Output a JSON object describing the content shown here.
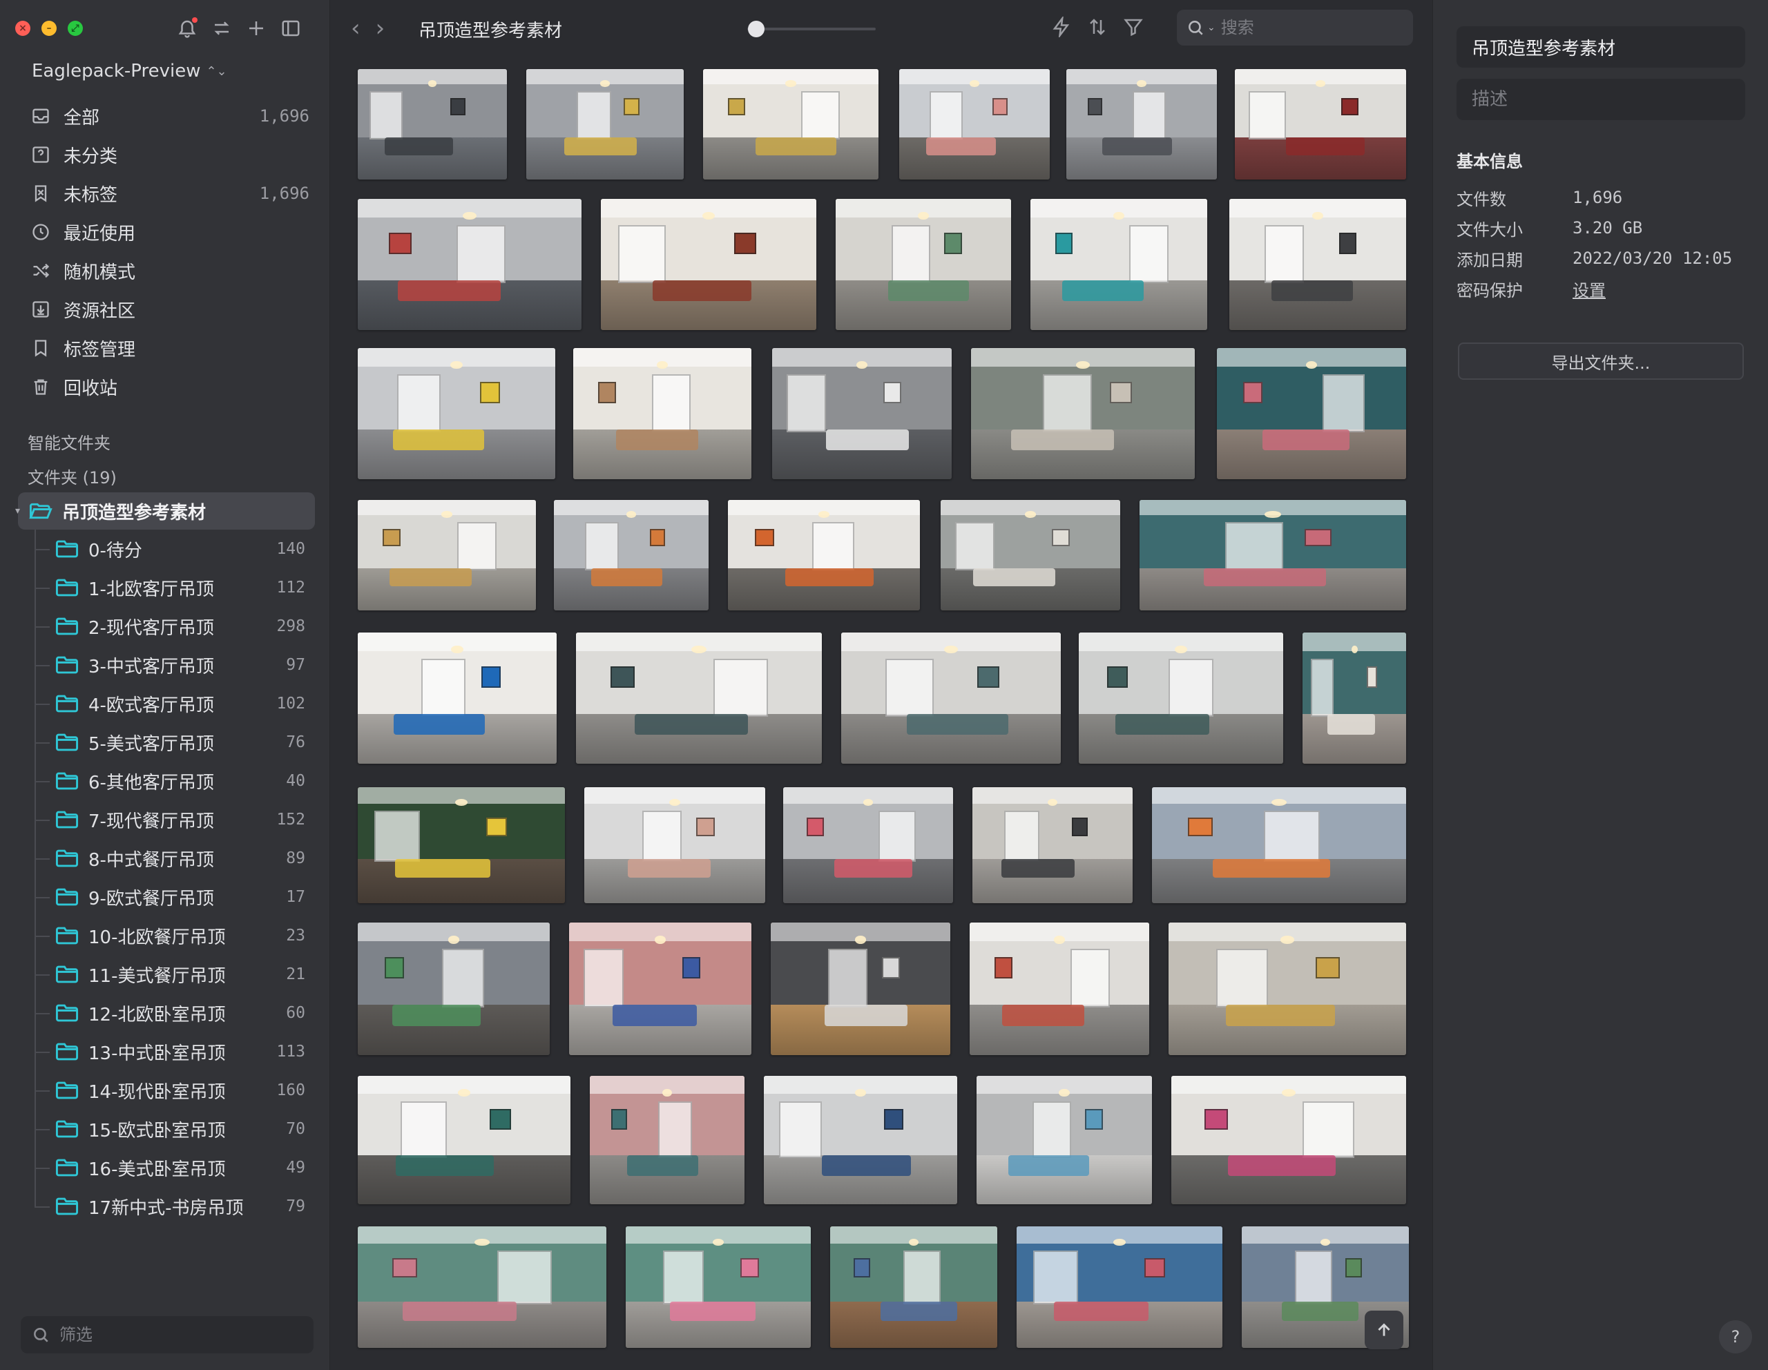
{
  "window": {
    "controls": [
      "close",
      "minimize",
      "zoom"
    ]
  },
  "sidebar": {
    "library_name": "Eaglepack-Preview",
    "tool_icons": [
      "bell-icon",
      "swap-icon",
      "plus-icon",
      "sidebar-toggle-icon"
    ],
    "nav": [
      {
        "label": "全部",
        "count": "1,696",
        "icon": "inbox-icon"
      },
      {
        "label": "未分类",
        "count": "",
        "icon": "question-box-icon"
      },
      {
        "label": "未标签",
        "count": "1,696",
        "icon": "tag-off-icon"
      },
      {
        "label": "最近使用",
        "count": "",
        "icon": "clock-icon"
      },
      {
        "label": "随机模式",
        "count": "",
        "icon": "shuffle-icon"
      },
      {
        "label": "资源社区",
        "count": "",
        "icon": "download-box-icon"
      },
      {
        "label": "标签管理",
        "count": "",
        "icon": "bookmark-icon"
      },
      {
        "label": "回收站",
        "count": "",
        "icon": "trash-icon"
      }
    ],
    "smart_folders_label": "智能文件夹",
    "folders_label": "文件夹 (19)",
    "root_folder": "吊顶造型参考素材",
    "subfolders": [
      {
        "label": "0-待分",
        "count": "140"
      },
      {
        "label": "1-北欧客厅吊顶",
        "count": "112"
      },
      {
        "label": "2-现代客厅吊顶",
        "count": "298"
      },
      {
        "label": "3-中式客厅吊顶",
        "count": "97"
      },
      {
        "label": "4-欧式客厅吊顶",
        "count": "102"
      },
      {
        "label": "5-美式客厅吊顶",
        "count": "76"
      },
      {
        "label": "6-其他客厅吊顶",
        "count": "40"
      },
      {
        "label": "7-现代餐厅吊顶",
        "count": "152"
      },
      {
        "label": "8-中式餐厅吊顶",
        "count": "89"
      },
      {
        "label": "9-欧式餐厅吊顶",
        "count": "17"
      },
      {
        "label": "10-北欧餐厅吊顶",
        "count": "23"
      },
      {
        "label": "11-美式餐厅吊顶",
        "count": "21"
      },
      {
        "label": "12-北欧卧室吊顶",
        "count": "60"
      },
      {
        "label": "13-中式卧室吊顶",
        "count": "113"
      },
      {
        "label": "14-现代卧室吊顶",
        "count": "160"
      },
      {
        "label": "15-欧式卧室吊顶",
        "count": "70"
      },
      {
        "label": "16-美式卧室吊顶",
        "count": "49"
      },
      {
        "label": "17新中式-书房吊顶",
        "count": "79"
      }
    ],
    "filter_placeholder": "筛选"
  },
  "toolbar": {
    "title": "吊顶造型参考素材",
    "zoom_level": 0.05,
    "search_placeholder": "搜索",
    "action_icons": [
      "lightning-icon",
      "sort-icon",
      "filter-icon"
    ]
  },
  "grid": {
    "rows": [
      [
        {
          "wall": "#8e9196",
          "floor": "#6b6f75",
          "accent": "#3a3d42"
        },
        {
          "wall": "#9fa2a7",
          "floor": "#7b7e83",
          "accent": "#d4b24a"
        },
        {
          "wall": "#e6e3dd",
          "floor": "#8c8a86",
          "accent": "#c9a84a"
        },
        {
          "wall": "#c9ccd0",
          "floor": "#6d6a66",
          "accent": "#d88f8a"
        },
        {
          "wall": "#a6a9ad",
          "floor": "#8a8c90",
          "accent": "#4b4e53"
        },
        {
          "wall": "#dddcd8",
          "floor": "#7a3e3e",
          "accent": "#8b2a2a"
        }
      ],
      [
        {
          "wall": "#b4b6b9",
          "floor": "#565a60",
          "accent": "#b7433f"
        },
        {
          "wall": "#e7e3dc",
          "floor": "#8f7f6e",
          "accent": "#8a3a2a"
        },
        {
          "wall": "#d6d4cf",
          "floor": "#8f8c87",
          "accent": "#5d8a6a"
        },
        {
          "wall": "#e4e3e0",
          "floor": "#9a9894",
          "accent": "#2a9aa0"
        },
        {
          "wall": "#e6e5e2",
          "floor": "#6c6966",
          "accent": "#3e3f42"
        }
      ],
      [
        {
          "wall": "#c6c8cb",
          "floor": "#8b8c8f",
          "accent": "#e2c33a"
        },
        {
          "wall": "#e8e5df",
          "floor": "#a19e98",
          "accent": "#b08560"
        },
        {
          "wall": "#8d8f92",
          "floor": "#5c5e62",
          "accent": "#e9e9e9"
        },
        {
          "wall": "#7d857e",
          "floor": "#8a8a86",
          "accent": "#c7c0b5"
        },
        {
          "wall": "#2f5d63",
          "floor": "#8b7f76",
          "accent": "#c96b7a"
        }
      ],
      [
        {
          "wall": "#d9d8d4",
          "floor": "#9e9b95",
          "accent": "#c89c50"
        },
        {
          "wall": "#b3b6ba",
          "floor": "#7e7f82",
          "accent": "#d47a3a"
        },
        {
          "wall": "#e4e2de",
          "floor": "#6d6a66",
          "accent": "#d3652e"
        },
        {
          "wall": "#9da19f",
          "floor": "#6a6a68",
          "accent": "#e0ddd6"
        },
        {
          "wall": "#3d6b70",
          "floor": "#8e8a86",
          "accent": "#c76a78"
        }
      ],
      [
        {
          "wall": "#eceae6",
          "floor": "#a7a4a0",
          "accent": "#1f69b8"
        },
        {
          "wall": "#dcdbd8",
          "floor": "#8e8c89",
          "accent": "#3e5558"
        },
        {
          "wall": "#d4d3d0",
          "floor": "#8b8986",
          "accent": "#4c6a6d"
        },
        {
          "wall": "#cfd0cf",
          "floor": "#8a8986",
          "accent": "#3f5c5a"
        },
        {
          "wall": "#3f6a6c",
          "floor": "#9d9690",
          "accent": "#e6e2da"
        }
      ],
      [
        {
          "wall": "#2f4a33",
          "floor": "#5a4e44",
          "accent": "#e5c53a"
        },
        {
          "wall": "#d9d9d9",
          "floor": "#9b9a98",
          "accent": "#cfa090"
        },
        {
          "wall": "#b6b8bb",
          "floor": "#6d6e71",
          "accent": "#d45a6a"
        },
        {
          "wall": "#c7c5c0",
          "floor": "#9e9b97",
          "accent": "#3a3b3e"
        },
        {
          "wall": "#9aa6b4",
          "floor": "#7d7e80",
          "accent": "#e07a3a"
        }
      ],
      [
        {
          "wall": "#7e838a",
          "floor": "#5d5a57",
          "accent": "#4d8f5c"
        },
        {
          "wall": "#c48a88",
          "floor": "#a9a6a2",
          "accent": "#3c5aa2"
        },
        {
          "wall": "#4a4b4e",
          "floor": "#b58c5a",
          "accent": "#d8d8d8"
        },
        {
          "wall": "#dedcd8",
          "floor": "#8f8d8a",
          "accent": "#c05040"
        },
        {
          "wall": "#c2beb6",
          "floor": "#a29c93",
          "accent": "#c9a24a"
        }
      ],
      [
        {
          "wall": "#e3e2df",
          "floor": "#5e5c5a",
          "accent": "#2f6b63"
        },
        {
          "wall": "#c39494",
          "floor": "#8c8a87",
          "accent": "#3d6f72"
        },
        {
          "wall": "#cfd0d1",
          "floor": "#9b9a98",
          "accent": "#2f4f7c"
        },
        {
          "wall": "#b6b7b8",
          "floor": "#c9c8c6",
          "accent": "#5a9abc"
        },
        {
          "wall": "#e1dfdb",
          "floor": "#6b6a68",
          "accent": "#c44a78"
        }
      ],
      [
        {
          "wall": "#5f8c80",
          "floor": "#8e8a87",
          "accent": "#c87a8a"
        },
        {
          "wall": "#5e8f82",
          "floor": "#a09d99",
          "accent": "#e07a9a"
        },
        {
          "wall": "#5a8476",
          "floor": "#8f6b4e",
          "accent": "#4d6fa0"
        },
        {
          "wall": "#3f6e9a",
          "floor": "#9c9690",
          "accent": "#c85a6a"
        },
        {
          "wall": "#6f8196",
          "floor": "#8f8d8a",
          "accent": "#5a8a5c"
        }
      ]
    ]
  },
  "inspector": {
    "name_value": "吊顶造型参考素材",
    "description_placeholder": "描述",
    "basic_info_title": "基本信息",
    "info": [
      {
        "key": "文件数",
        "value": "1,696"
      },
      {
        "key": "文件大小",
        "value": "3.20 GB"
      },
      {
        "key": "添加日期",
        "value": "2022/03/20 12:05"
      },
      {
        "key": "密码保护",
        "value": "设置"
      }
    ],
    "export_label": "导出文件夹...",
    "help_label": "?"
  }
}
